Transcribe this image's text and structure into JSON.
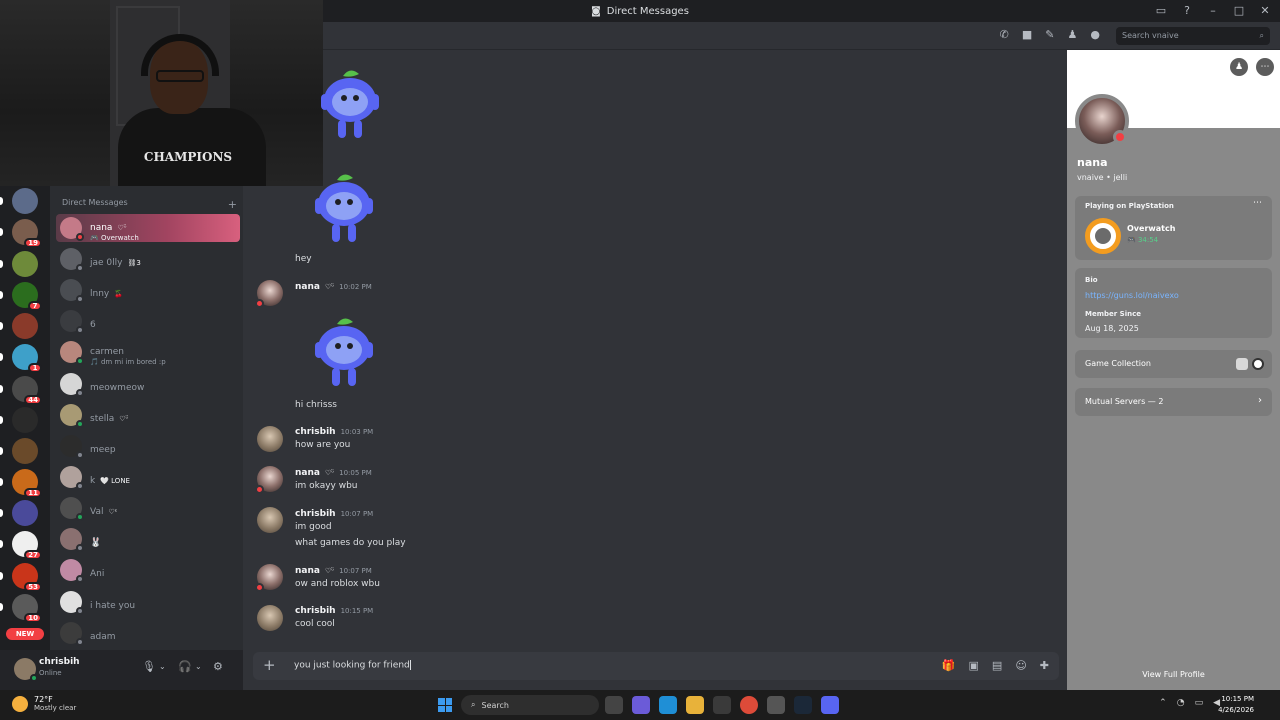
{
  "window": {
    "title": "Direct Messages"
  },
  "search": {
    "placeholder": "Search vnaive"
  },
  "dm_header": {
    "title": "Direct Messages",
    "add": "+"
  },
  "dms": [
    {
      "name": "nana",
      "tag": "♡ᵕ̈",
      "sub": "🎮 Overwatch",
      "color": "#c47a88",
      "status": "#f23f43"
    },
    {
      "name": "jae 0lly",
      "tag": "⛓3",
      "sub": "",
      "color": "#5e6066",
      "status": "#80848e"
    },
    {
      "name": "lnny",
      "tag": "🍒",
      "sub": "",
      "color": "#4a4d52",
      "status": "#80848e"
    },
    {
      "name": "6",
      "tag": "",
      "sub": "",
      "color": "#3a3c40",
      "status": "#80848e"
    },
    {
      "name": "carmen",
      "tag": "",
      "sub": "🎵 dm mi im bored :p",
      "color": "#b8877d",
      "status": "#23a55a"
    },
    {
      "name": "meowmeow",
      "tag": "",
      "sub": "",
      "color": "#d6d6d6",
      "status": "#80848e"
    },
    {
      "name": "stella",
      "tag": "♡ᵕ̈",
      "sub": "",
      "color": "#a89a74",
      "status": "#23a55a"
    },
    {
      "name": "meep",
      "tag": "",
      "sub": "",
      "color": "#2c2c2c",
      "status": "#80848e"
    },
    {
      "name": "k",
      "tag": "🤍 LONE",
      "sub": "",
      "color": "#b0a19c",
      "status": "#80848e"
    },
    {
      "name": "Val",
      "tag": "♡ᵋ",
      "sub": "",
      "color": "#4f4f4f",
      "status": "#23a55a"
    },
    {
      "name": "🐰",
      "tag": "",
      "sub": "",
      "color": "#8a7070",
      "status": "#80848e"
    },
    {
      "name": "Ani",
      "tag": "",
      "sub": "",
      "color": "#c08aa4",
      "status": "#80848e"
    },
    {
      "name": "i hate you",
      "tag": "",
      "sub": "",
      "color": "#e0e0e0",
      "status": "#80848e"
    },
    {
      "name": "adam",
      "tag": "",
      "sub": "",
      "color": "#3c3c3c",
      "status": "#80848e"
    }
  ],
  "servers": [
    {
      "color": "#5c6b8a",
      "badge": ""
    },
    {
      "color": "#7a5d4d",
      "badge": "19"
    },
    {
      "color": "#6e8a3a",
      "badge": ""
    },
    {
      "color": "#2b6d1e",
      "badge": "7"
    },
    {
      "color": "#8a3a2a",
      "badge": ""
    },
    {
      "color": "#3ea0c9",
      "badge": "1"
    },
    {
      "color": "#4a4a4a",
      "badge": "44"
    },
    {
      "color": "#2a2a2a",
      "badge": ""
    },
    {
      "color": "#6a4a2a",
      "badge": ""
    },
    {
      "color": "#c96a1a",
      "badge": "11"
    },
    {
      "color": "#4a4a9a",
      "badge": ""
    },
    {
      "color": "#efefef",
      "badge": "27"
    },
    {
      "color": "#c9351a",
      "badge": "53"
    },
    {
      "color": "#5a5a5a",
      "badge": "10"
    }
  ],
  "new_label": "NEW",
  "user": {
    "name": "chrisbih",
    "status": "Online"
  },
  "messages": {
    "m1": "hey",
    "nana": "nana",
    "nana_tag": "♡ᵕ̈",
    "chris": "chrisbih",
    "t1": "10:02 PM",
    "m2": "hi chrisss",
    "t2": "10:03 PM",
    "m3": "how are you",
    "t3": "10:05 PM",
    "m4": "im okayy wbu",
    "t4": "10:07 PM",
    "m5": "im good",
    "m6": "what games do you play",
    "t5": "10:07 PM",
    "m7": "ow and roblox wbu",
    "t6": "10:15 PM",
    "m8": "cool cool"
  },
  "composer": {
    "text": "you just looking for friend"
  },
  "profile": {
    "name": "nana",
    "username": "vnaive • jelli",
    "activity_label": "Playing on PlayStation",
    "game": "Overwatch",
    "game_time": "🎮 34:54",
    "bio_label": "Bio",
    "bio_link": "https://guns.lol/naivexo",
    "member_since_label": "Member Since",
    "member_since": "Aug 18, 2025",
    "game_collection": "Game Collection",
    "mutual_servers": "Mutual Servers — 2",
    "view_full": "View Full Profile"
  },
  "taskbar": {
    "temp": "72°F",
    "weather": "Mostly clear",
    "search": "Search",
    "time": "10:15 PM",
    "date": "4/26/2026"
  },
  "webcam": {
    "shirt_text": "CHAMPIONS"
  }
}
